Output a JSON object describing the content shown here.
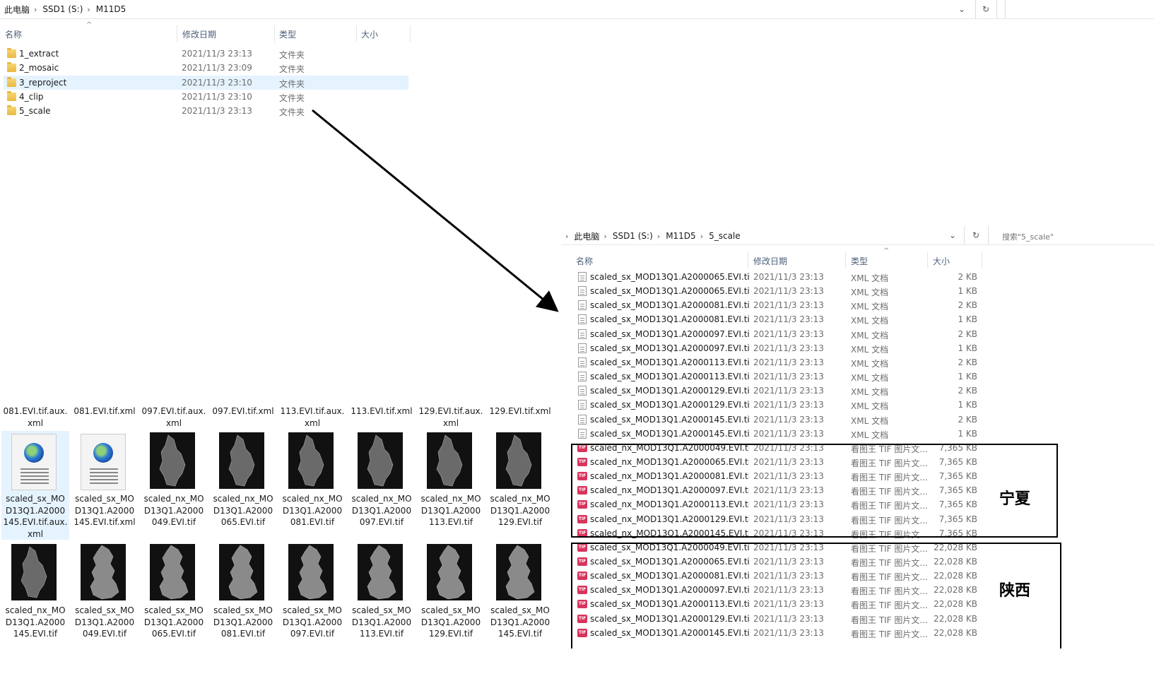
{
  "top_window": {
    "breadcrumb": [
      "此电脑",
      "SSD1 (S:)",
      "M11D5"
    ],
    "columns": {
      "name": "名称",
      "modified": "修改日期",
      "type": "类型",
      "size": "大小"
    },
    "folders": [
      {
        "name": "1_extract",
        "date": "2021/11/3 23:13",
        "type": "文件夹"
      },
      {
        "name": "2_mosaic",
        "date": "2021/11/3 23:09",
        "type": "文件夹"
      },
      {
        "name": "3_reproject",
        "date": "2021/11/3 23:10",
        "type": "文件夹"
      },
      {
        "name": "4_clip",
        "date": "2021/11/3 23:10",
        "type": "文件夹"
      },
      {
        "name": "5_scale",
        "date": "2021/11/3 23:13",
        "type": "文件夹"
      }
    ]
  },
  "right_window": {
    "breadcrumb": [
      "此电脑",
      "SSD1 (S:)",
      "M11D5",
      "5_scale"
    ],
    "search_placeholder": "搜索\"5_scale\"",
    "columns": {
      "name": "名称",
      "modified": "修改日期",
      "type": "类型",
      "size": "大小"
    },
    "files": [
      {
        "icon": "xml",
        "name": "scaled_sx_MOD13Q1.A2000065.EVI.tif...",
        "date": "2021/11/3 23:13",
        "type": "XML 文档",
        "size": "2 KB"
      },
      {
        "icon": "xml",
        "name": "scaled_sx_MOD13Q1.A2000065.EVI.tif...",
        "date": "2021/11/3 23:13",
        "type": "XML 文档",
        "size": "1 KB"
      },
      {
        "icon": "xml",
        "name": "scaled_sx_MOD13Q1.A2000081.EVI.tif...",
        "date": "2021/11/3 23:13",
        "type": "XML 文档",
        "size": "2 KB"
      },
      {
        "icon": "xml",
        "name": "scaled_sx_MOD13Q1.A2000081.EVI.tif...",
        "date": "2021/11/3 23:13",
        "type": "XML 文档",
        "size": "1 KB"
      },
      {
        "icon": "xml",
        "name": "scaled_sx_MOD13Q1.A2000097.EVI.tif...",
        "date": "2021/11/3 23:13",
        "type": "XML 文档",
        "size": "2 KB"
      },
      {
        "icon": "xml",
        "name": "scaled_sx_MOD13Q1.A2000097.EVI.tif...",
        "date": "2021/11/3 23:13",
        "type": "XML 文档",
        "size": "1 KB"
      },
      {
        "icon": "xml",
        "name": "scaled_sx_MOD13Q1.A2000113.EVI.tif...",
        "date": "2021/11/3 23:13",
        "type": "XML 文档",
        "size": "2 KB"
      },
      {
        "icon": "xml",
        "name": "scaled_sx_MOD13Q1.A2000113.EVI.tif...",
        "date": "2021/11/3 23:13",
        "type": "XML 文档",
        "size": "1 KB"
      },
      {
        "icon": "xml",
        "name": "scaled_sx_MOD13Q1.A2000129.EVI.tif...",
        "date": "2021/11/3 23:13",
        "type": "XML 文档",
        "size": "2 KB"
      },
      {
        "icon": "xml",
        "name": "scaled_sx_MOD13Q1.A2000129.EVI.tif...",
        "date": "2021/11/3 23:13",
        "type": "XML 文档",
        "size": "1 KB"
      },
      {
        "icon": "xml",
        "name": "scaled_sx_MOD13Q1.A2000145.EVI.tif...",
        "date": "2021/11/3 23:13",
        "type": "XML 文档",
        "size": "2 KB"
      },
      {
        "icon": "xml",
        "name": "scaled_sx_MOD13Q1.A2000145.EVI.tif...",
        "date": "2021/11/3 23:13",
        "type": "XML 文档",
        "size": "1 KB"
      },
      {
        "icon": "tif",
        "name": "scaled_nx_MOD13Q1.A2000049.EVI.tif",
        "date": "2021/11/3 23:13",
        "type": "看图王 TIF 图片文...",
        "size": "7,365 KB"
      },
      {
        "icon": "tif",
        "name": "scaled_nx_MOD13Q1.A2000065.EVI.tif",
        "date": "2021/11/3 23:13",
        "type": "看图王 TIF 图片文...",
        "size": "7,365 KB"
      },
      {
        "icon": "tif",
        "name": "scaled_nx_MOD13Q1.A2000081.EVI.tif",
        "date": "2021/11/3 23:13",
        "type": "看图王 TIF 图片文...",
        "size": "7,365 KB"
      },
      {
        "icon": "tif",
        "name": "scaled_nx_MOD13Q1.A2000097.EVI.tif",
        "date": "2021/11/3 23:13",
        "type": "看图王 TIF 图片文...",
        "size": "7,365 KB"
      },
      {
        "icon": "tif",
        "name": "scaled_nx_MOD13Q1.A2000113.EVI.tif",
        "date": "2021/11/3 23:13",
        "type": "看图王 TIF 图片文...",
        "size": "7,365 KB"
      },
      {
        "icon": "tif",
        "name": "scaled_nx_MOD13Q1.A2000129.EVI.tif",
        "date": "2021/11/3 23:13",
        "type": "看图王 TIF 图片文...",
        "size": "7,365 KB"
      },
      {
        "icon": "tif",
        "name": "scaled_nx_MOD13Q1.A2000145.EVI.tif",
        "date": "2021/11/3 23:13",
        "type": "看图王 TIF 图片文...",
        "size": "7,365 KB"
      },
      {
        "icon": "tif",
        "name": "scaled_sx_MOD13Q1.A2000049.EVI.tif",
        "date": "2021/11/3 23:13",
        "type": "看图王 TIF 图片文...",
        "size": "22,028 KB"
      },
      {
        "icon": "tif",
        "name": "scaled_sx_MOD13Q1.A2000065.EVI.tif",
        "date": "2021/11/3 23:13",
        "type": "看图王 TIF 图片文...",
        "size": "22,028 KB"
      },
      {
        "icon": "tif",
        "name": "scaled_sx_MOD13Q1.A2000081.EVI.tif",
        "date": "2021/11/3 23:13",
        "type": "看图王 TIF 图片文...",
        "size": "22,028 KB"
      },
      {
        "icon": "tif",
        "name": "scaled_sx_MOD13Q1.A2000097.EVI.tif",
        "date": "2021/11/3 23:13",
        "type": "看图王 TIF 图片文...",
        "size": "22,028 KB"
      },
      {
        "icon": "tif",
        "name": "scaled_sx_MOD13Q1.A2000113.EVI.tif",
        "date": "2021/11/3 23:13",
        "type": "看图王 TIF 图片文...",
        "size": "22,028 KB"
      },
      {
        "icon": "tif",
        "name": "scaled_sx_MOD13Q1.A2000129.EVI.tif",
        "date": "2021/11/3 23:13",
        "type": "看图王 TIF 图片文...",
        "size": "22,028 KB"
      },
      {
        "icon": "tif",
        "name": "scaled_sx_MOD13Q1.A2000145.EVI.tif",
        "date": "2021/11/3 23:13",
        "type": "看图王 TIF 图片文...",
        "size": "22,028 KB"
      }
    ]
  },
  "annotations": {
    "ningxia": "宁夏",
    "shaanxi": "陕西"
  },
  "thumbs_partial_row": [
    [
      "081.EVI.tif.aux.",
      "xml"
    ],
    [
      "081.EVI.tif.xml"
    ],
    [
      "097.EVI.tif.aux.",
      "xml"
    ],
    [
      "097.EVI.tif.xml"
    ],
    [
      "113.EVI.tif.aux.",
      "xml"
    ],
    [
      "113.EVI.tif.xml"
    ],
    [
      "129.EVI.tif.aux.",
      "xml"
    ],
    [
      "129.EVI.tif.xml"
    ]
  ],
  "thumbs_row1": [
    {
      "kind": "xml",
      "cap": [
        "scaled_sx_MO",
        "D13Q1.A2000",
        "145.EVI.tif.aux.",
        "xml"
      ]
    },
    {
      "kind": "xml",
      "cap": [
        "scaled_sx_MO",
        "D13Q1.A2000",
        "145.EVI.tif.xml"
      ]
    },
    {
      "kind": "nx",
      "cap": [
        "scaled_nx_MO",
        "D13Q1.A2000",
        "049.EVI.tif"
      ]
    },
    {
      "kind": "nx",
      "cap": [
        "scaled_nx_MO",
        "D13Q1.A2000",
        "065.EVI.tif"
      ]
    },
    {
      "kind": "nx",
      "cap": [
        "scaled_nx_MO",
        "D13Q1.A2000",
        "081.EVI.tif"
      ]
    },
    {
      "kind": "nx",
      "cap": [
        "scaled_nx_MO",
        "D13Q1.A2000",
        "097.EVI.tif"
      ]
    },
    {
      "kind": "nx",
      "cap": [
        "scaled_nx_MO",
        "D13Q1.A2000",
        "113.EVI.tif"
      ]
    },
    {
      "kind": "nx",
      "cap": [
        "scaled_nx_MO",
        "D13Q1.A2000",
        "129.EVI.tif"
      ]
    }
  ],
  "thumbs_row2": [
    {
      "kind": "nx",
      "cap": [
        "scaled_nx_MO",
        "D13Q1.A2000",
        "145.EVI.tif"
      ]
    },
    {
      "kind": "sx",
      "cap": [
        "scaled_sx_MO",
        "D13Q1.A2000",
        "049.EVI.tif"
      ]
    },
    {
      "kind": "sx",
      "cap": [
        "scaled_sx_MO",
        "D13Q1.A2000",
        "065.EVI.tif"
      ]
    },
    {
      "kind": "sx",
      "cap": [
        "scaled_sx_MO",
        "D13Q1.A2000",
        "081.EVI.tif"
      ]
    },
    {
      "kind": "sx",
      "cap": [
        "scaled_sx_MO",
        "D13Q1.A2000",
        "097.EVI.tif"
      ]
    },
    {
      "kind": "sx",
      "cap": [
        "scaled_sx_MO",
        "D13Q1.A2000",
        "113.EVI.tif"
      ]
    },
    {
      "kind": "sx",
      "cap": [
        "scaled_sx_MO",
        "D13Q1.A2000",
        "129.EVI.tif"
      ]
    },
    {
      "kind": "sx",
      "cap": [
        "scaled_sx_MO",
        "D13Q1.A2000",
        "145.EVI.tif"
      ]
    }
  ],
  "colors": {
    "selected_row": "#e5f3ff",
    "header_text": "#4c607a",
    "tif_icon": "#d8345c",
    "frame": "#000000"
  }
}
